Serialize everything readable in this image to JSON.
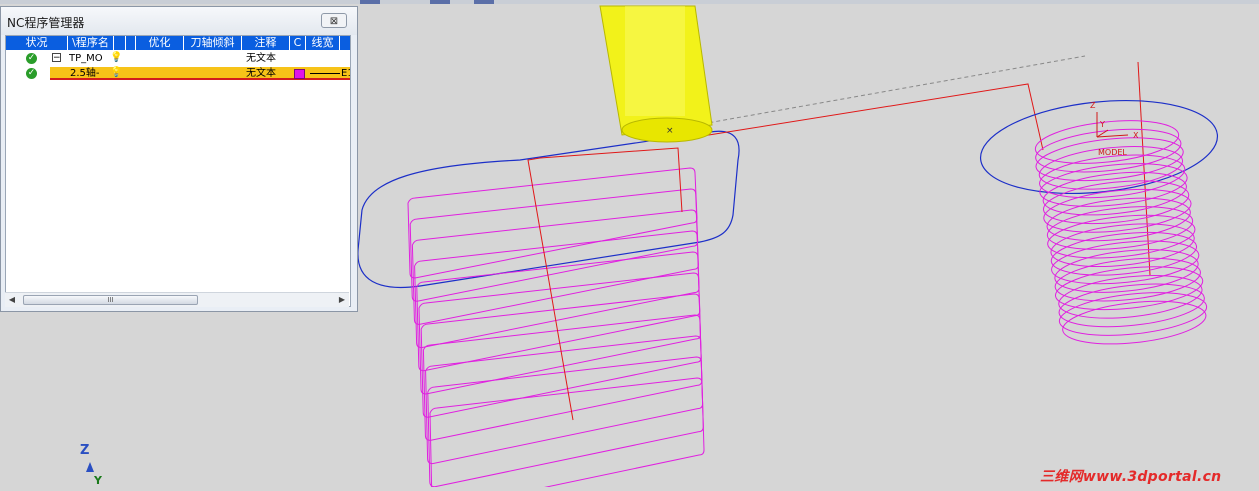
{
  "window": {
    "title": "NC程序管理器",
    "close_label": "⊠",
    "columns": [
      "状况",
      "\\程序名",
      "",
      "",
      "优化",
      "刀轴倾斜",
      "注释",
      "C",
      "线宽",
      ""
    ],
    "rows": [
      {
        "name": "TP_MO",
        "comment": "无文本",
        "color": "",
        "linetype": ""
      },
      {
        "name": "2.5轴-",
        "comment": "无文本",
        "color": "#e014e8",
        "linetype": "E1"
      }
    ],
    "scrollbar_grip": "III"
  },
  "viewport": {
    "model_label": "MODEL",
    "model_axis_z": "Z",
    "model_axis_y": "Y",
    "model_axis_x": "X",
    "triad_z": "Z",
    "triad_y": "Y",
    "tool_marker": "×"
  },
  "colors": {
    "tool": "#f2f21a",
    "toolpath": "#e020e0",
    "blank": "#1c2fc8",
    "link_path": "#e01818",
    "highlight_row": "#f7c318",
    "header": "#0a5ee0"
  },
  "watermark": "三维网www.3dportal.cn"
}
